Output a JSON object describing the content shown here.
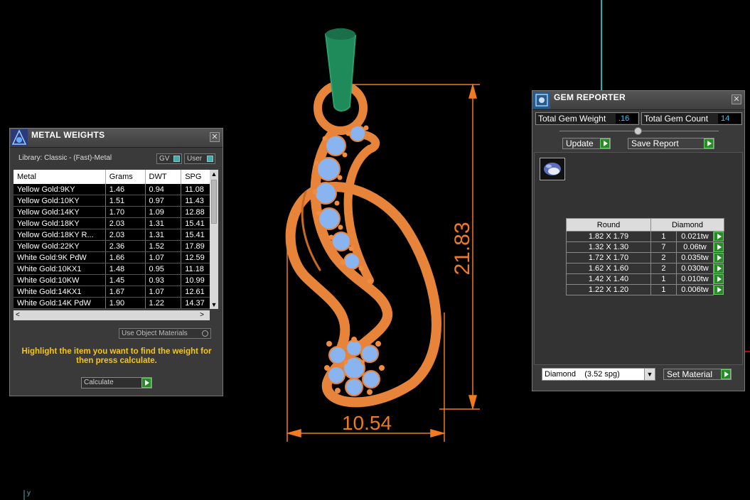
{
  "viewport": {
    "width_dimension": "10.54",
    "height_dimension": "21.83",
    "axis_label": "y"
  },
  "metal_weights": {
    "title": "METAL WEIGHTS",
    "library_label": "Library: Classic - (Fast)-Metal",
    "gv_label": "GV",
    "user_label": "User",
    "columns": [
      "Metal",
      "Grams",
      "DWT",
      "SPG"
    ],
    "rows": [
      {
        "metal": "Yellow Gold:9KY",
        "grams": "1.46",
        "dwt": "0.94",
        "spg": "11.08"
      },
      {
        "metal": "Yellow Gold:10KY",
        "grams": "1.51",
        "dwt": "0.97",
        "spg": "11.43"
      },
      {
        "metal": "Yellow Gold:14KY",
        "grams": "1.70",
        "dwt": "1.09",
        "spg": "12.88"
      },
      {
        "metal": "Yellow Gold:18KY",
        "grams": "2.03",
        "dwt": "1.31",
        "spg": "15.41"
      },
      {
        "metal": "Yellow Gold:18KY R...",
        "grams": "2.03",
        "dwt": "1.31",
        "spg": "15.41"
      },
      {
        "metal": "Yellow Gold:22KY",
        "grams": "2.36",
        "dwt": "1.52",
        "spg": "17.89"
      },
      {
        "metal": "White Gold:9K PdW",
        "grams": "1.66",
        "dwt": "1.07",
        "spg": "12.59"
      },
      {
        "metal": "White Gold:10KX1",
        "grams": "1.48",
        "dwt": "0.95",
        "spg": "11.18"
      },
      {
        "metal": "White Gold:10KW",
        "grams": "1.45",
        "dwt": "0.93",
        "spg": "10.99"
      },
      {
        "metal": "White Gold:14KX1",
        "grams": "1.67",
        "dwt": "1.07",
        "spg": "12.61"
      },
      {
        "metal": "White Gold:14K PdW",
        "grams": "1.90",
        "dwt": "1.22",
        "spg": "14.37"
      }
    ],
    "use_object_materials_label": "Use Object Materials",
    "instructions": "Highlight the item you want to find the weight for then press calculate.",
    "calculate_label": "Calculate"
  },
  "gem_reporter": {
    "title": "GEM REPORTER",
    "total_weight_label": "Total Gem Weight",
    "total_weight_value": ".16",
    "total_count_label": "Total Gem Count",
    "total_count_value": "14",
    "update_label": "Update",
    "save_report_label": "Save Report",
    "shape_header": "Round",
    "material_header": "Diamond",
    "rows": [
      {
        "size": "1.82 X 1.79",
        "count": "1",
        "weight": "0.021tw"
      },
      {
        "size": "1.32 X 1.30",
        "count": "7",
        "weight": "0.06tw"
      },
      {
        "size": "1.72 X 1.70",
        "count": "2",
        "weight": "0.035tw"
      },
      {
        "size": "1.62 X 1.60",
        "count": "2",
        "weight": "0.030tw"
      },
      {
        "size": "1.42 X 1.40",
        "count": "1",
        "weight": "0.010tw"
      },
      {
        "size": "1.22 X 1.20",
        "count": "1",
        "weight": "0.006tw"
      }
    ],
    "material_select": "Diamond    (3.52 spg)",
    "set_material_label": "Set Material"
  },
  "colors": {
    "metal": "#e8843a",
    "gem": "#8ab4f0",
    "bail": "#1f8a5a",
    "dimension": "#f07a20",
    "accent": "#2a8a2a"
  }
}
